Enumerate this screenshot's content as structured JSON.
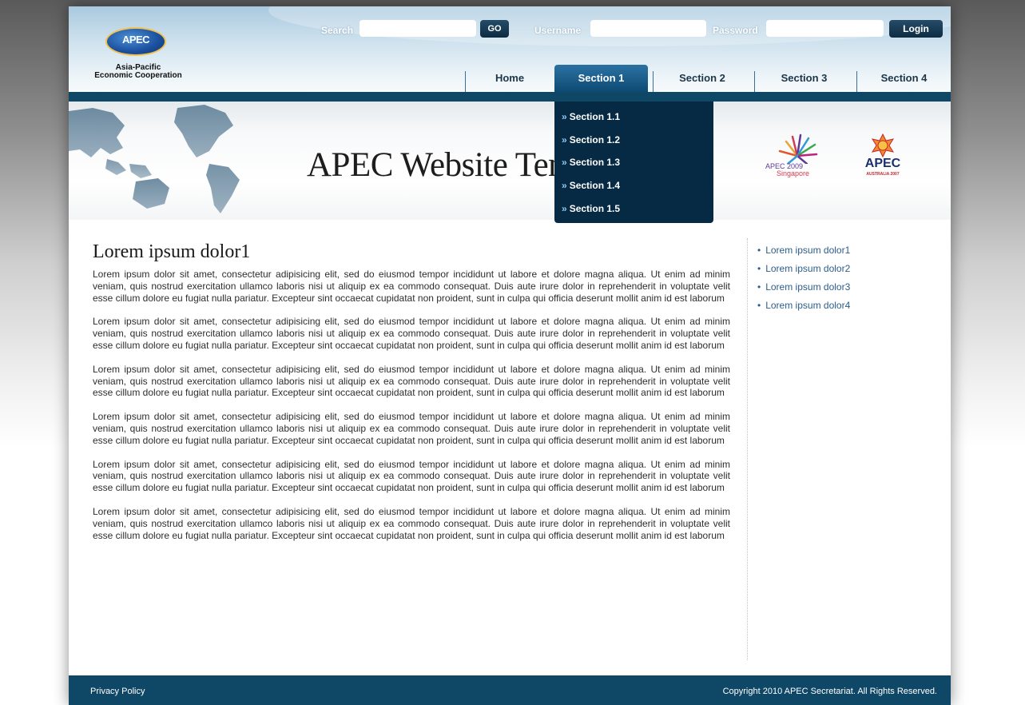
{
  "header": {
    "logo_text": "APEC",
    "logo_tagline_line1": "Asia-Pacific",
    "logo_tagline_line2": "Economic Cooperation",
    "search_label": "Search",
    "search_value": "",
    "go_label": "GO",
    "username_label": "Username",
    "username_value": "",
    "password_label": "Password",
    "password_value": "",
    "login_label": "Login"
  },
  "nav": {
    "items": [
      {
        "label": "Home"
      },
      {
        "label": "Section 1"
      },
      {
        "label": "Section 2"
      },
      {
        "label": "Section 3"
      },
      {
        "label": "Section 4"
      }
    ],
    "active": "Section 1"
  },
  "dropdown": {
    "arrow": "»",
    "items": [
      {
        "label": "Section 1.1"
      },
      {
        "label": "Section 1.2"
      },
      {
        "label": "Section 1.3"
      },
      {
        "label": "Section 1.4"
      },
      {
        "label": "Section 1.5"
      }
    ]
  },
  "banner": {
    "title": "APEC Website Templates",
    "logo_singapore_line1": "APEC 2009",
    "logo_singapore_line2": "Singapore",
    "logo_australia_line1": "APEC",
    "logo_australia_line2": "AUSTRALIA 2007"
  },
  "main": {
    "heading": "Lorem ipsum dolor1",
    "paragraphs": [
      "Lorem ipsum dolor sit amet, consectetur adipisicing elit, sed do eiusmod tempor incididunt ut labore et dolore magna aliqua. Ut enim ad minim veniam, quis nostrud exercitation ullamco laboris nisi ut aliquip ex ea commodo consequat. Duis aute irure dolor in reprehenderit in voluptate velit esse cillum dolore eu fugiat nulla pariatur. Excepteur sint occaecat cupidatat non proident, sunt in culpa qui officia deserunt mollit anim id est laborum",
      "Lorem ipsum dolor sit amet, consectetur adipisicing elit, sed do eiusmod tempor incididunt ut labore et dolore magna aliqua. Ut enim ad minim veniam, quis nostrud exercitation ullamco laboris nisi ut aliquip ex ea commodo consequat. Duis aute irure dolor in reprehenderit in voluptate velit esse cillum dolore eu fugiat nulla pariatur. Excepteur sint occaecat cupidatat non proident, sunt in culpa qui officia deserunt mollit anim id est laborum",
      "Lorem ipsum dolor sit amet, consectetur adipisicing elit, sed do eiusmod tempor incididunt ut labore et dolore magna aliqua. Ut enim ad minim veniam, quis nostrud exercitation ullamco laboris nisi ut aliquip ex ea commodo consequat. Duis aute irure dolor in reprehenderit in voluptate velit esse cillum dolore eu fugiat nulla pariatur. Excepteur sint occaecat cupidatat non proident, sunt in culpa qui officia deserunt mollit anim id est laborum",
      "Lorem ipsum dolor sit amet, consectetur adipisicing elit, sed do eiusmod tempor incididunt ut labore et dolore magna aliqua. Ut enim ad minim veniam, quis nostrud exercitation ullamco laboris nisi ut aliquip ex ea commodo consequat. Duis aute irure dolor in reprehenderit in voluptate velit esse cillum dolore eu fugiat nulla pariatur. Excepteur sint occaecat cupidatat non proident, sunt in culpa qui officia deserunt mollit anim id est laborum",
      "Lorem ipsum dolor sit amet, consectetur adipisicing elit, sed do eiusmod tempor incididunt ut labore et dolore magna aliqua. Ut enim ad minim veniam, quis nostrud exercitation ullamco laboris nisi ut aliquip ex ea commodo consequat. Duis aute irure dolor in reprehenderit in voluptate velit esse cillum dolore eu fugiat nulla pariatur. Excepteur sint occaecat cupidatat non proident, sunt in culpa qui officia deserunt mollit anim id est laborum",
      "Lorem ipsum dolor sit amet, consectetur adipisicing elit, sed do eiusmod tempor incididunt ut labore et dolore magna aliqua. Ut enim ad minim veniam, quis nostrud exercitation ullamco laboris nisi ut aliquip ex ea commodo consequat. Duis aute irure dolor in reprehenderit in voluptate velit esse cillum dolore eu fugiat nulla pariatur. Excepteur sint occaecat cupidatat non proident, sunt in culpa qui officia deserunt mollit anim id est laborum"
    ]
  },
  "sidebar": {
    "bullet": "•",
    "links": [
      {
        "label": "Lorem ipsum dolor1"
      },
      {
        "label": "Lorem ipsum dolor2"
      },
      {
        "label": "Lorem ipsum dolor3"
      },
      {
        "label": "Lorem ipsum dolor4"
      }
    ]
  },
  "footer": {
    "privacy_label": "Privacy Policy",
    "copyright": "Copyright 2010 APEC Secretariat. All Rights Reserved."
  },
  "colors": {
    "navy": "#0f4767",
    "dropdown_bg": "#062a44",
    "link_blue": "#2c5d8a"
  }
}
